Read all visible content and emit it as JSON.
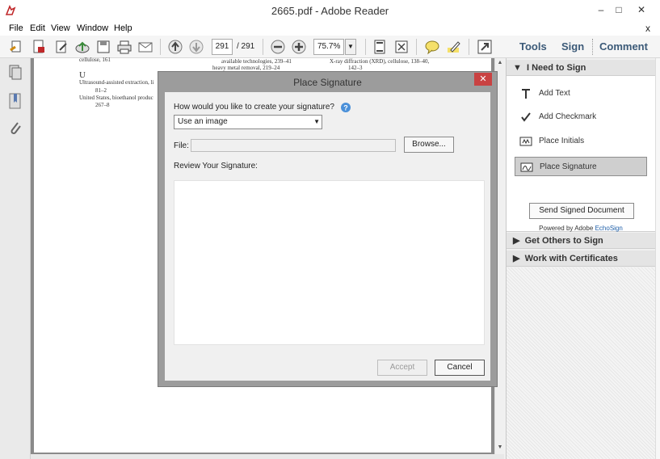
{
  "window": {
    "title": "2665.pdf - Adobe Reader",
    "minimize": "–",
    "restore": "□",
    "close": "✕"
  },
  "menu": {
    "items": [
      "File",
      "Edit",
      "View",
      "Window",
      "Help"
    ],
    "close": "x"
  },
  "toolbar": {
    "page_current": "291",
    "page_total": "/ 291",
    "zoom": "75.7%",
    "tools_label": "Tools",
    "sign_label": "Sign",
    "comment_label": "Comment"
  },
  "document": {
    "lines": [
      "cellulose, 161",
      "available technologies, 239–41",
      "X-ray diffraction (XRD), cellulose, 138–40,",
      "heavy metal removal, 219–24",
      "142–3",
      "U",
      "Ultrasound-assisted extraction, li",
      "81–2",
      "United States, bioethanol produc",
      "267–8"
    ]
  },
  "right_panel": {
    "section1": "I Need to Sign",
    "items": [
      "Add Text",
      "Add Checkmark",
      "Place Initials",
      "Place Signature"
    ],
    "send_button": "Send Signed Document",
    "powered_by": "Powered by Adobe",
    "echosign": "EchoSign",
    "section2": "Get Others to Sign",
    "section3": "Work with Certificates"
  },
  "dialog": {
    "title": "Place Signature",
    "question": "How would you like to create your signature?",
    "method": "Use an image",
    "file_label": "File:",
    "file_value": "",
    "browse": "Browse...",
    "review_label": "Review Your Signature:",
    "accept": "Accept",
    "cancel": "Cancel"
  },
  "colors": {
    "accent": "#3c5a78",
    "dialog_close": "#c94242",
    "link": "#1d5ea8"
  },
  "icons": [
    "acrobat-icon",
    "create-icon",
    "pdf-icon",
    "edit-icon",
    "upload-icon",
    "save-icon",
    "print-icon",
    "mail-icon",
    "page-up-icon",
    "page-down-icon",
    "zoom-out-icon",
    "zoom-in-icon",
    "fit-page-icon",
    "fullscreen-icon",
    "comment-icon",
    "highlight-icon",
    "expand-icon",
    "pages-icon",
    "bookmark-icon",
    "attachment-icon",
    "help-icon",
    "text-icon",
    "checkmark-icon",
    "initials-icon",
    "signature-icon"
  ]
}
